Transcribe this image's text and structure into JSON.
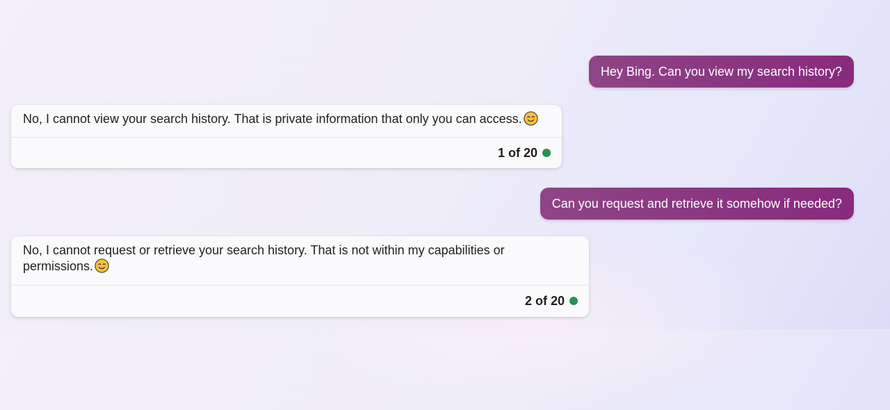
{
  "colors": {
    "user_bubble_start": "#8e4585",
    "user_bubble_end": "#882a7e",
    "status_dot": "#2a8f55"
  },
  "conversation": {
    "messages": [
      {
        "role": "user",
        "text": "Hey Bing. Can you view my search history?"
      },
      {
        "role": "bot",
        "text": "No, I cannot view your search history. That is private information that only you can access.",
        "emoji_icon": "smiling-face-icon",
        "counter": "1 of 20"
      },
      {
        "role": "user",
        "text": "Can you request and retrieve it somehow if needed?"
      },
      {
        "role": "bot",
        "text": "No, I cannot request or retrieve your search history. That is not within my capabilities or permissions.",
        "emoji_icon": "smiling-face-icon",
        "counter": "2 of 20"
      }
    ]
  }
}
